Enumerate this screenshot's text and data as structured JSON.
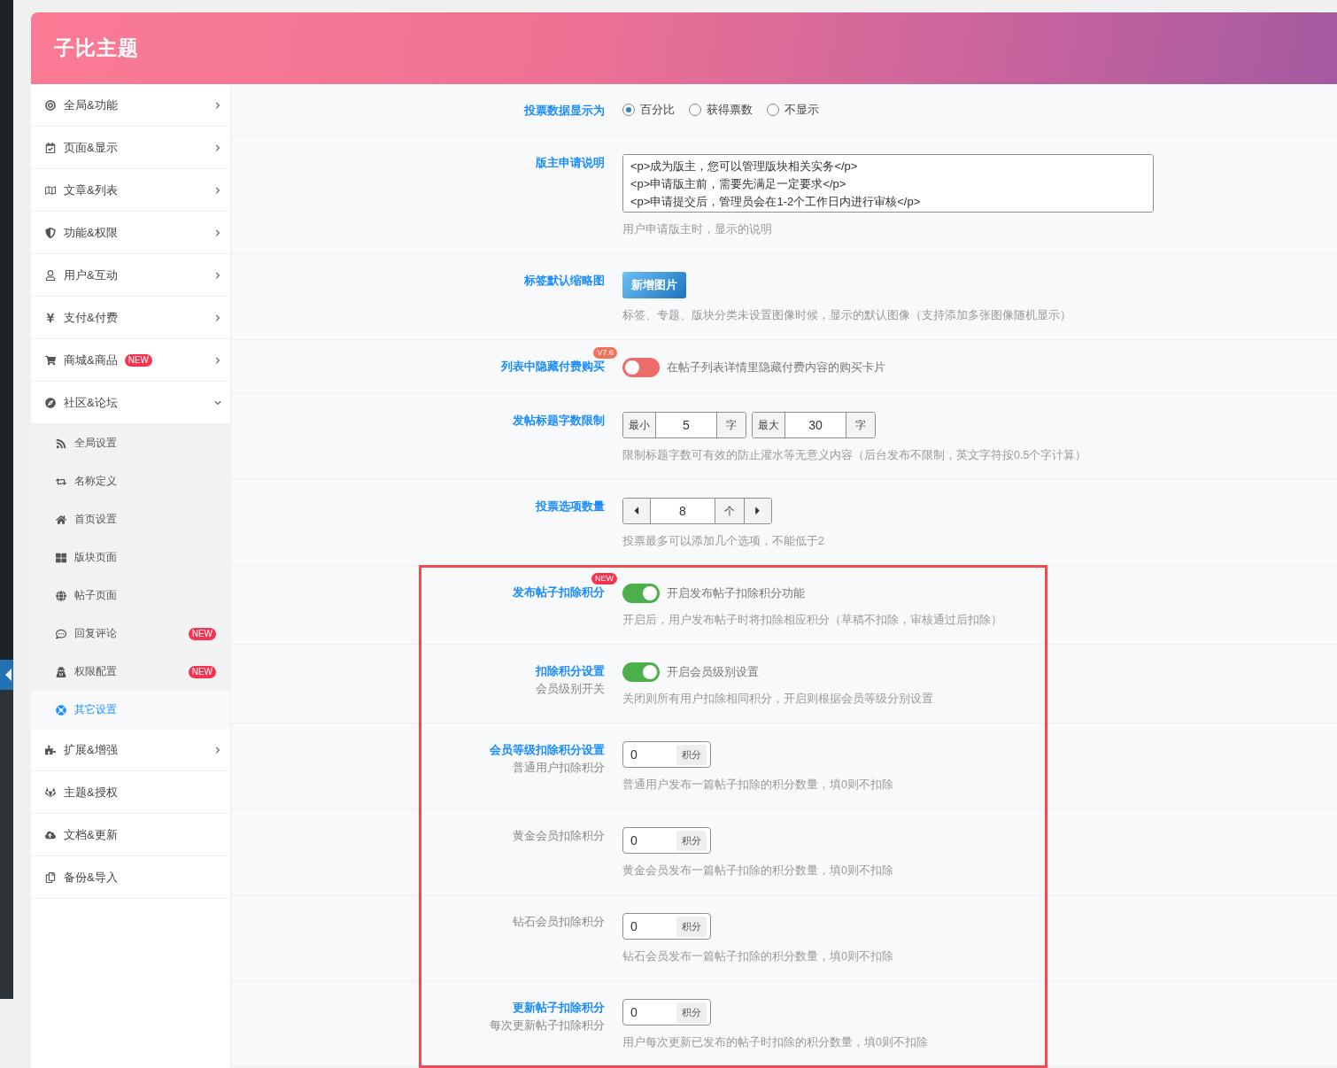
{
  "header": {
    "title": "子比主题"
  },
  "sidebar": {
    "items": [
      {
        "label": "全局&功能",
        "expanded": false
      },
      {
        "label": "页面&显示",
        "expanded": false
      },
      {
        "label": "文章&列表",
        "expanded": false
      },
      {
        "label": "功能&权限",
        "expanded": false
      },
      {
        "label": "用户&互动",
        "expanded": false
      },
      {
        "label": "支付&付费",
        "expanded": false
      },
      {
        "label": "商城&商品",
        "badge": "NEW",
        "expanded": false
      },
      {
        "label": "社区&论坛",
        "expanded": true,
        "children": [
          {
            "label": "全局设置",
            "selected": false
          },
          {
            "label": "名称定义",
            "selected": false
          },
          {
            "label": "首页设置",
            "selected": false
          },
          {
            "label": "版块页面",
            "selected": false
          },
          {
            "label": "帖子页面",
            "selected": false
          },
          {
            "label": "回复评论",
            "badge": "NEW",
            "selected": false
          },
          {
            "label": "权限配置",
            "badge": "NEW",
            "selected": false
          },
          {
            "label": "其它设置",
            "selected": true
          }
        ]
      },
      {
        "label": "扩展&增强",
        "expanded": false
      },
      {
        "label": "主题&授权"
      },
      {
        "label": "文档&更新"
      },
      {
        "label": "备份&导入"
      }
    ]
  },
  "rows": [
    {
      "kind": "radio",
      "label": "投票数据显示为",
      "primary": true,
      "options": [
        {
          "label": "百分比",
          "selected": true
        },
        {
          "label": "获得票数",
          "selected": false
        },
        {
          "label": "不显示",
          "selected": false
        }
      ]
    },
    {
      "kind": "textarea",
      "label": "版主申请说明",
      "primary": true,
      "value": "<p>成为版主，您可以管理版块相关实务</p>\n<p>申请版主前，需要先满足一定要求</p>\n<p>申请提交后，管理员会在1-2个工作日内进行审核</p>",
      "help": "用户申请版主时，显示的说明"
    },
    {
      "kind": "upload",
      "label": "标签默认缩略图",
      "primary": true,
      "button": "新增图片",
      "help": "标签、专题、版块分类未设置图像时候，显示的默认图像（支持添加多张图像随机显示）"
    },
    {
      "kind": "toggle",
      "label": "列表中隐藏付费购买",
      "primary": true,
      "badge": "V7.6",
      "on": false,
      "text": "在帖子列表详情里隐藏付费内容的购买卡片"
    },
    {
      "kind": "range",
      "label": "发帖标题字数限制",
      "primary": true,
      "min_label": "最小",
      "min": "5",
      "min_unit": "字",
      "max_label": "最大",
      "max": "30",
      "max_unit": "字",
      "help": "限制标题字数可有效的防止灌水等无意义内容（后台发布不限制，英文字符按0.5个字计算）"
    },
    {
      "kind": "stepper",
      "label": "投票选项数量",
      "primary": true,
      "value": "8",
      "unit": "个",
      "help": "投票最多可以添加几个选项，不能低于2"
    },
    {
      "kind": "toggle",
      "label": "发布帖子扣除积分",
      "primary": true,
      "badge": "NEW",
      "on": true,
      "text": "开启发布帖子扣除积分功能",
      "help": "开启后，用户发布帖子时将扣除相应积分（草稿不扣除，审核通过后扣除）",
      "highlighted": true
    },
    {
      "kind": "toggle",
      "label": "扣除积分设置",
      "sublabel": "会员级别开关",
      "primary": true,
      "on": true,
      "text": "开启会员级别设置",
      "help": "关闭则所有用户扣除相同积分，开启则根据会员等级分别设置",
      "highlighted": true
    },
    {
      "kind": "points",
      "label": "会员等级扣除积分设置",
      "sublabel": "普通用户扣除积分",
      "primary": true,
      "value": "0",
      "unit": "积分",
      "help": "普通用户发布一篇帖子扣除的积分数量，填0则不扣除",
      "highlighted": true
    },
    {
      "kind": "points",
      "label": "黄金会员扣除积分",
      "primary": false,
      "value": "0",
      "unit": "积分",
      "help": "黄金会员发布一篇帖子扣除的积分数量，填0则不扣除",
      "highlighted": true
    },
    {
      "kind": "points",
      "label": "钻石会员扣除积分",
      "primary": false,
      "value": "0",
      "unit": "积分",
      "help": "钻石会员发布一篇帖子扣除的积分数量，填0则不扣除",
      "highlighted": true
    },
    {
      "kind": "points",
      "label": "更新帖子扣除积分",
      "sublabel": "每次更新帖子扣除积分",
      "primary": true,
      "value": "0",
      "unit": "积分",
      "help": "用户每次更新已发布的帖子时扣除的积分数量，填0则不扣除",
      "highlighted": true
    }
  ]
}
